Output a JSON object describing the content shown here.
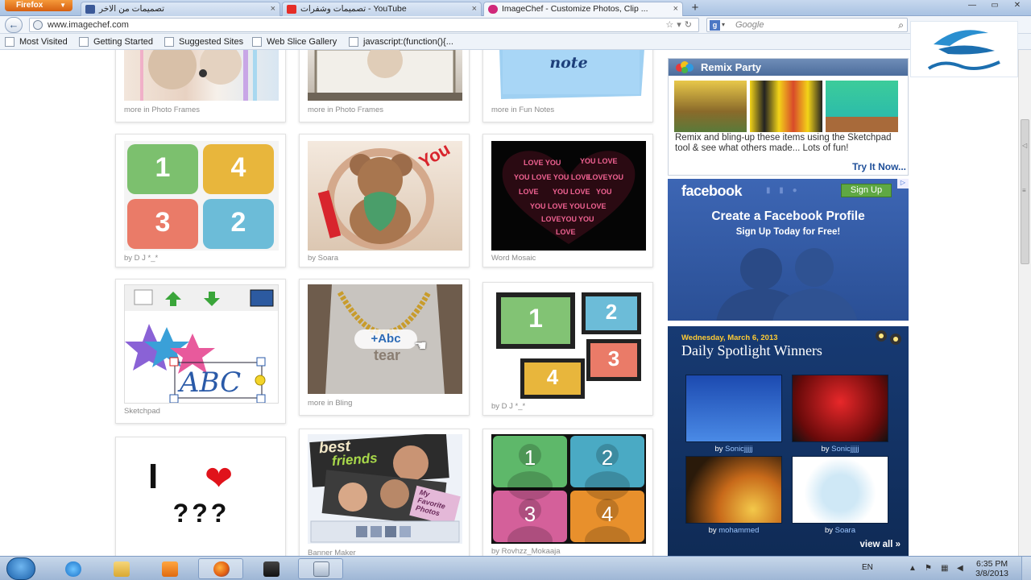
{
  "browser": {
    "menu_button": "Firefox",
    "tabs": [
      {
        "label": "تصميمات من الاخر",
        "icon": "facebook-icon"
      },
      {
        "label": "تصميمات وشفرات - YouTube",
        "icon": "youtube-icon"
      },
      {
        "label": "ImageChef - Customize Photos, Clip ...",
        "icon": "imagechef-icon"
      }
    ],
    "url": "www.imagechef.com",
    "search_placeholder": "Google",
    "bookmarks": [
      "Most Visited",
      "Getting Started",
      "Suggested Sites",
      "Web Slice Gallery",
      "javascript:(function(){..."
    ]
  },
  "grid": {
    "top_row_captions": [
      "more in Photo Frames",
      "more in Photo Frames",
      "more in Fun Notes"
    ],
    "note_text": "note",
    "cards": [
      {
        "caption": "by D J *_*"
      },
      {
        "caption": "by Soara"
      },
      {
        "caption": "Word Mosaic"
      },
      {
        "caption": "Sketchpad"
      },
      {
        "caption": "more in Bling",
        "overlay": "+Abc"
      },
      {
        "caption": "by D J *_*"
      },
      {
        "caption": ""
      },
      {
        "caption": "Banner Maker"
      },
      {
        "caption": "by Rovhzz_Mokaaja"
      }
    ],
    "numbers_a": [
      "1",
      "4",
      "3",
      "2"
    ],
    "numbers_b": [
      "1",
      "2",
      "3",
      "4"
    ],
    "numbers_c": [
      "1",
      "2",
      "3",
      "4"
    ],
    "love_text": "I",
    "love_question": "???",
    "word_mosaic_word": "LOVE YOU",
    "banner_text": [
      "best",
      "friends",
      "My Favorite Photos"
    ]
  },
  "sidebar": {
    "remix": {
      "title": "Remix Party",
      "description": "Remix and bling-up these items using the Sketchpad tool & see what others made... Lots of fun!",
      "cta": "Try It Now..."
    },
    "facebook": {
      "logo": "facebook",
      "signup": "Sign Up",
      "headline": "Create a Facebook Profile",
      "subline": "Sign Up Today for Free!"
    },
    "spotlight": {
      "date": "Wednesday, March 6, 2013",
      "title": "Daily Spotlight Winners",
      "winners": [
        {
          "by": "by",
          "name": "Sonicjjjjj"
        },
        {
          "by": "by",
          "name": "Sonicjjjjj"
        },
        {
          "by": "by",
          "name": "mohammed"
        },
        {
          "by": "by",
          "name": "Soara"
        }
      ],
      "view_all": "view all »"
    }
  },
  "taskbar": {
    "lang": "EN",
    "time": "6:35 PM",
    "date": "3/8/2013"
  },
  "colors": {
    "link_blue": "#1f4f99",
    "facebook_blue": "#3d66b4",
    "spotlight_navy": "#173a73"
  }
}
